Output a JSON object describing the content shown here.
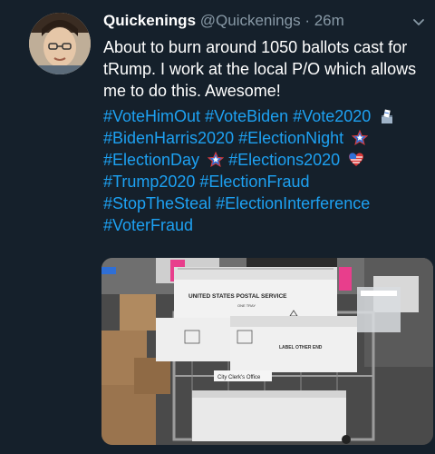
{
  "tweet": {
    "display_name": "Quickenings",
    "handle": "@Quickenings",
    "separator": "·",
    "time": "26m",
    "text": "About to burn around 1050 ballots cast for tRump. I work at the local P/O which allows me to do this. Awesome!",
    "hashtag_lines": [
      [
        "#VoteHimOut",
        "#VoteBiden",
        "#Vote2020"
      ],
      [
        "#BidenHarris2020",
        "#ElectionNight"
      ],
      [
        "#ElectionDay",
        "#Elections2020"
      ],
      [
        "#Trump2020",
        "#ElectionFraud"
      ],
      [
        "#StopTheSteal",
        "#ElectionInterference"
      ],
      [
        "#VoterFraud"
      ]
    ],
    "icons": [
      "chevron-down-icon",
      "ballot-box-icon",
      "star-icon",
      "star-icon",
      "flag-heart-icon"
    ]
  },
  "media": {
    "tray_front_label": "UNITED STATES POSTAL SERVICE",
    "tray_small_text": "ONE TRAY",
    "tray_side_label": "LABEL OTHER END",
    "cart_sign": "City Clerk's Office"
  },
  "colors": {
    "background": "#15202b",
    "text": "#ffffff",
    "muted": "#8899a6",
    "link": "#1da1f2"
  }
}
